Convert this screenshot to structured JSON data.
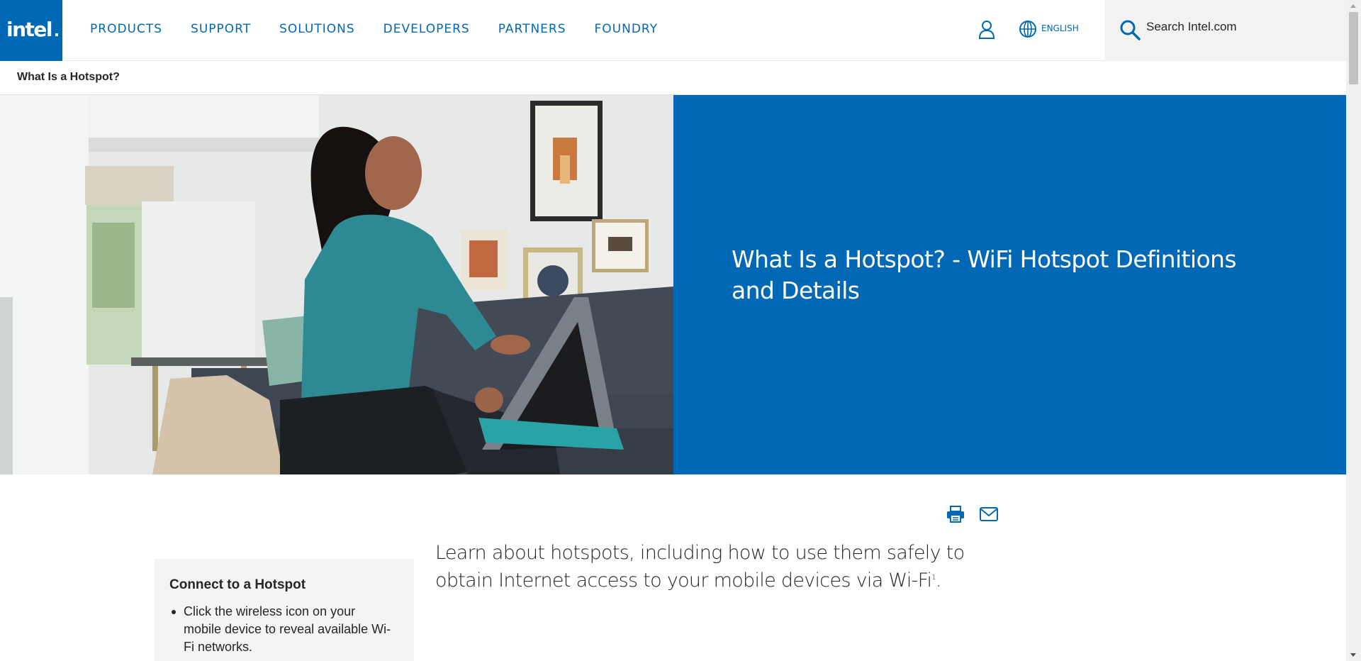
{
  "header": {
    "logo_text": "intel",
    "nav": [
      "PRODUCTS",
      "SUPPORT",
      "SOLUTIONS",
      "DEVELOPERS",
      "PARTNERS",
      "FOUNDRY"
    ],
    "user_icon": "user-icon",
    "language_label": "ENGLISH",
    "search_placeholder": "Search Intel.com"
  },
  "breadcrumb": {
    "title": "What Is a Hotspot?"
  },
  "hero": {
    "title": "What Is a Hotspot? - WiFi Hotspot Definitions and Details",
    "image_alt": "Woman sitting on a couch using a convertible laptop"
  },
  "share": {
    "icons": [
      "print-icon",
      "email-icon"
    ]
  },
  "sidebar": {
    "title": "Connect to a Hotspot",
    "items": [
      "Click the wireless icon on your mobile device to reveal available Wi-Fi networks."
    ]
  },
  "intro": {
    "text": "Learn about hotspots, including how to use them safely to obtain Internet access to your mobile devices via Wi-Fi",
    "footnote": "1",
    "end": "."
  },
  "colors": {
    "brand_blue": "#0068b5",
    "text": "#262626",
    "sidebar_bg": "#f4f4f4"
  }
}
